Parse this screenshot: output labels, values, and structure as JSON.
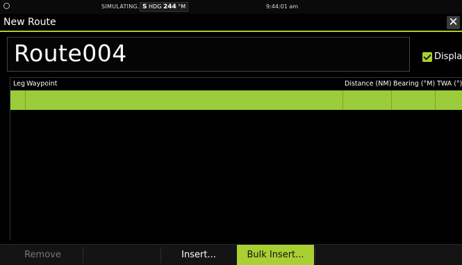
{
  "status_bar": {
    "mode": "SIMULATING...",
    "heading_label": "HDG",
    "heading_prefix": "S",
    "heading_value": "244",
    "heading_unit": "°M",
    "clock": "9:44:01 am"
  },
  "title_bar": {
    "title": "New Route",
    "close_symbol": "✕"
  },
  "route": {
    "name": "Route004",
    "display_label": "Display",
    "display_checked": true
  },
  "table": {
    "columns": [
      "Leg",
      "Waypoint",
      "Distance (NM)",
      "Bearing (°M)",
      "TWA (°)"
    ],
    "rows": [
      {
        "leg": "",
        "waypoint": "",
        "distance": "",
        "bearing": "",
        "twa": ""
      }
    ]
  },
  "toolbar": {
    "remove_label": "Remove",
    "insert_label": "Insert...",
    "bulk_insert_label": "Bulk Insert..."
  },
  "colors": {
    "accent": "#a9d033",
    "row_highlight": "#9bcc3c"
  }
}
